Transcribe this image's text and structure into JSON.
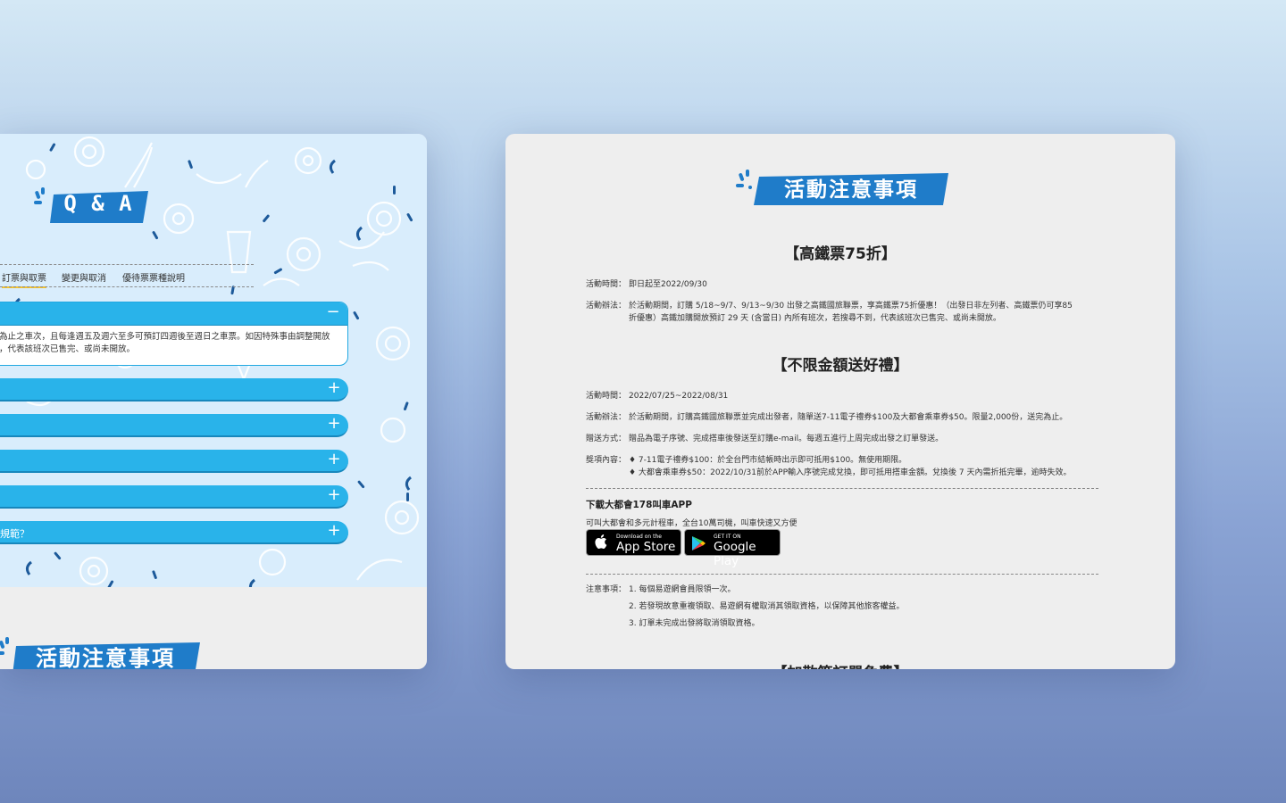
{
  "left_card": {
    "logo_text": "Q & A",
    "tabs": [
      "訂票與取票",
      "變更與取消",
      "優待票票種說明"
    ],
    "open_item": {
      "body_line1": "為止之車次，且每逢週五及週六至多可預訂四週後至週日之車票。如因特殊事由調整開放",
      "body_line2": "，代表該班次已售完、或尚未開放。"
    },
    "collapsed_last_label": "規範？",
    "bottom_logo_text": "活動注意事項"
  },
  "right_card": {
    "logo_text": "活動注意事項",
    "section1": {
      "title": "【高鐵票75折】",
      "time_key": "活動時間：",
      "time_val": "即日起至2022/09/30",
      "method_key": "活動辦法：",
      "method_line1": "於活動期間，訂購 5/18~9/7、9/13~9/30 出發之高鐵國旅聯票，享高鐵票75折優惠！（出發日非左列者、高鐵票仍可享85",
      "method_line2": "折優惠）高鐵加購開放預訂 29 天 (含當日) 內所有班次，若搜尋不到，代表該班次已售完、或尚未開放。"
    },
    "section2": {
      "title": "【不限金額送好禮】",
      "time_key": "活動時間：",
      "time_val": "2022/07/25~2022/08/31",
      "method_key": "活動辦法：",
      "method_val": "於活動期間，訂購高鐵國旅聯票並完成出發者，隨單送7-11電子禮券$100及大都會乘車券$50。限量2,000份，送完為止。",
      "gift_key": "贈送方式：",
      "gift_val": "贈品為電子序號、完成搭車後發送至訂購e-mail。每週五進行上周完成出發之訂單發送。",
      "prize_key": "獎項內容：",
      "prize_line1": "♦ 7-11電子禮券$100：於全台門市結帳時出示即可抵用$100。無使用期限。",
      "prize_line2": "♦ 大都會乘車券$50：2022/10/31前於APP輸入序號完成兌換，即可抵用搭車金額。兌換後 7 天內需折抵完畢，逾時失效。"
    },
    "app": {
      "title": "下載大都會178叫車APP",
      "subtitle": "可叫大都會和多元計程車，全台10萬司機，叫車快速又方便",
      "appstore_small": "Download on the",
      "appstore_big": "App Store",
      "googleplay_small": "GET IT ON",
      "googleplay_big": "Google Play"
    },
    "notes": {
      "key": "注意事項：",
      "items": [
        "1. 每個易遊網會員限領一次。",
        "2. 若發現故意重複領取、易遊網有權取消其領取資格，以保障其他旅客權益。",
        "3. 訂單未完成出發將取消領取資格。"
      ]
    },
    "next_section_title": "【加散箱訂單免費】"
  },
  "colors": {
    "brand_blue": "#29b3ea",
    "logo_blue": "#1f7cc9",
    "pattern_bg": "#d9edfc",
    "tab_underline": "#f2c230"
  }
}
